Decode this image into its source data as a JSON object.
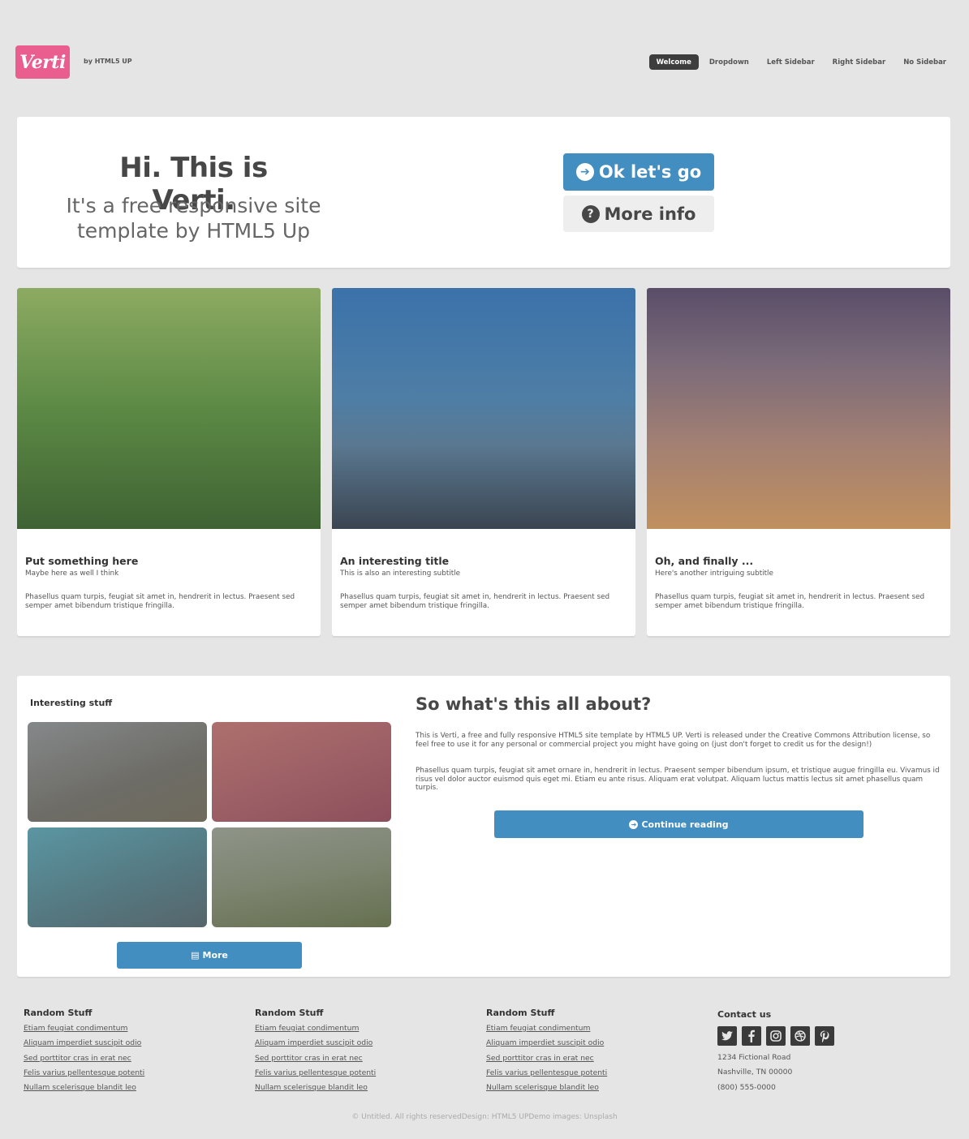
{
  "header": {
    "logo": "Verti",
    "byline": "by HTML5 UP",
    "nav": [
      "Welcome",
      "Dropdown",
      "Left Sidebar",
      "Right Sidebar",
      "No Sidebar"
    ]
  },
  "banner": {
    "title": "Hi. This is Verti.",
    "subtitle": "It's a free responsive site template by HTML5 Up",
    "primary_button": "Ok let's go",
    "secondary_button": "More info"
  },
  "features": [
    {
      "title": "Put something here",
      "subtitle": "Maybe here as well I think",
      "body": "Phasellus quam turpis, feugiat sit amet in, hendrerit in lectus. Praesent sed semper amet bibendum tristique fringilla."
    },
    {
      "title": "An interesting title",
      "subtitle": "This is also an interesting subtitle",
      "body": "Phasellus quam turpis, feugiat sit amet in, hendrerit in lectus. Praesent sed semper amet bibendum tristique fringilla."
    },
    {
      "title": "Oh, and finally ...",
      "subtitle": "Here's another intriguing subtitle",
      "body": "Phasellus quam turpis, feugiat sit amet in, hendrerit in lectus. Praesent sed semper amet bibendum tristique fringilla."
    }
  ],
  "sidebar": {
    "title": "Interesting stuff",
    "more_button": "More"
  },
  "article": {
    "title": "So what's this all about?",
    "p1": "This is Verti, a free and fully responsive HTML5 site template by HTML5 UP. Verti is released under the Creative Commons Attribution license, so feel free to use it for any personal or commercial project you might have going on (just don't forget to credit us for the design!)",
    "p2": "Phasellus quam turpis, feugiat sit amet ornare in, hendrerit in lectus. Praesent semper bibendum ipsum, et tristique augue fringilla eu. Vivamus id risus vel dolor auctor euismod quis eget mi. Etiam eu ante risus. Aliquam erat volutpat. Aliquam luctus mattis lectus sit amet phasellus quam turpis.",
    "button": "Continue reading"
  },
  "footer": {
    "columns": [
      {
        "title": "Random Stuff",
        "links": [
          "Etiam feugiat condimentum",
          "Aliquam imperdiet suscipit odio",
          "Sed porttitor cras in erat nec",
          "Felis varius pellentesque potenti",
          "Nullam scelerisque blandit leo"
        ]
      },
      {
        "title": "Random Stuff",
        "links": [
          "Etiam feugiat condimentum",
          "Aliquam imperdiet suscipit odio",
          "Sed porttitor cras in erat nec",
          "Felis varius pellentesque potenti",
          "Nullam scelerisque blandit leo"
        ]
      },
      {
        "title": "Random Stuff",
        "links": [
          "Etiam feugiat condimentum",
          "Aliquam imperdiet suscipit odio",
          "Sed porttitor cras in erat nec",
          "Felis varius pellentesque potenti",
          "Nullam scelerisque blandit leo"
        ]
      }
    ],
    "contact": {
      "title": "Contact us",
      "social_icons": [
        "twitter-icon",
        "facebook-icon",
        "instagram-icon",
        "dribbble-icon",
        "pinterest-icon"
      ],
      "address1": "1234 Fictional Road",
      "address2": "Nashville, TN 00000",
      "phone": "(800) 555-0000"
    },
    "copyright": "© Untitled. All rights reservedDesign: HTML5 UPDemo images: Unsplash"
  },
  "colors": {
    "background": "#e5e5e5",
    "logo": "#e95d8f",
    "accent": "#438ec0",
    "dark": "#3d3d3d"
  }
}
